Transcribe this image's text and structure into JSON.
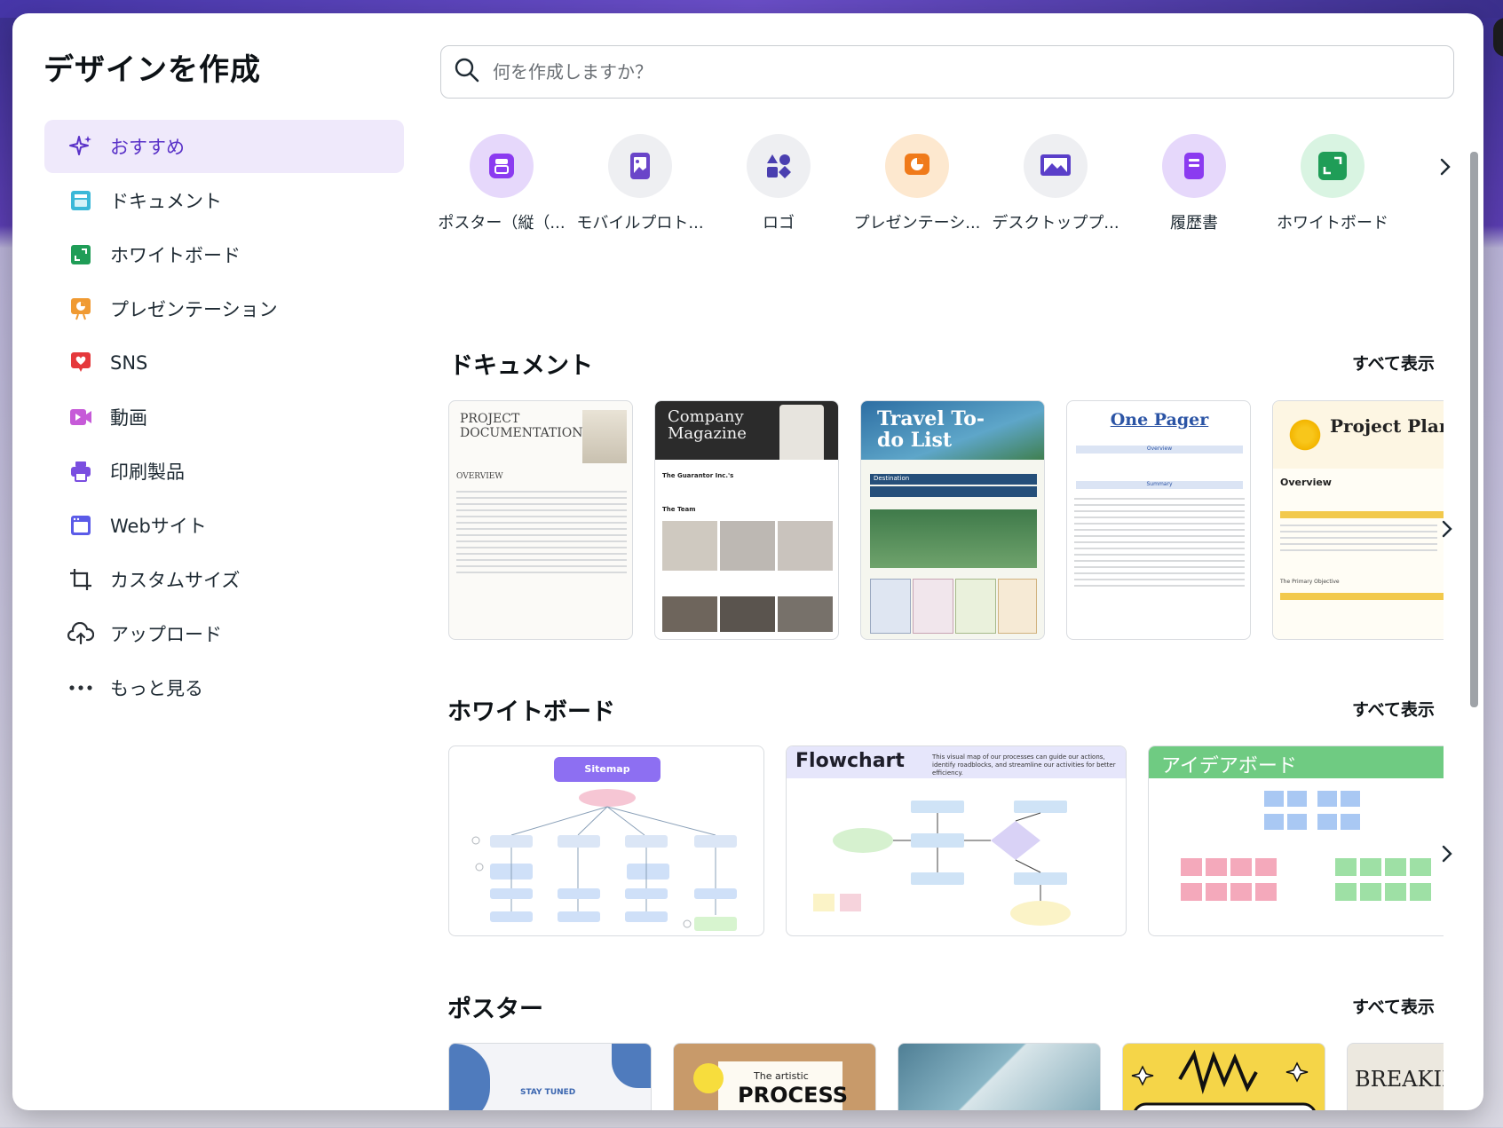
{
  "modal": {
    "title": "デザインを作成"
  },
  "sidebar": {
    "items": [
      {
        "label": "おすすめ",
        "icon": "sparkle-icon"
      },
      {
        "label": "ドキュメント",
        "icon": "doc-icon"
      },
      {
        "label": "ホワイトボード",
        "icon": "whiteboard-icon"
      },
      {
        "label": "プレゼンテーション",
        "icon": "presentation-icon"
      },
      {
        "label": "SNS",
        "icon": "heart-icon"
      },
      {
        "label": "動画",
        "icon": "video-icon"
      },
      {
        "label": "印刷製品",
        "icon": "printer-icon"
      },
      {
        "label": "Webサイト",
        "icon": "website-icon"
      },
      {
        "label": "カスタムサイズ",
        "icon": "crop-icon"
      },
      {
        "label": "アップロード",
        "icon": "upload-icon"
      },
      {
        "label": "もっと見る",
        "icon": "more-icon"
      }
    ]
  },
  "search": {
    "placeholder": "何を作成しますか？"
  },
  "quick": {
    "items": [
      {
        "label": "ポスター（縦（...",
        "color": "#e6d8fb",
        "icon": "poster-icon"
      },
      {
        "label": "モバイルプロト...",
        "color": "#eeeff2",
        "icon": "mobile-icon"
      },
      {
        "label": "ロゴ",
        "color": "#eeeff2",
        "icon": "logo-icon"
      },
      {
        "label": "プレゼンテーシ...",
        "color": "#fde8cf",
        "icon": "presentation-icon"
      },
      {
        "label": "デスクトッププ...",
        "color": "#eeeff2",
        "icon": "desktop-icon"
      },
      {
        "label": "履歴書",
        "color": "#e6d8fb",
        "icon": "resume-icon"
      },
      {
        "label": "ホワイトボード",
        "color": "#d9f4e2",
        "icon": "whiteboard-icon"
      }
    ]
  },
  "sections": {
    "documents": {
      "title": "ドキュメント",
      "see_all": "すべて表示",
      "cards": [
        {
          "title": "PROJECT DOCUMENTATION",
          "subtitle": "OVERVIEW"
        },
        {
          "title": "Company Magazine",
          "subtitle": "The Guarantor Inc.'s",
          "sub2": "The Team"
        },
        {
          "title": "Travel To-do List",
          "subtitle": "Destination"
        },
        {
          "title": "One Pager",
          "subtitle": "Overview",
          "sub2": "Summary"
        },
        {
          "title": "Project Plan",
          "subtitle": "Overview",
          "sub2": "The Primary Objective"
        }
      ]
    },
    "whiteboards": {
      "title": "ホワイトボード",
      "see_all": "すべて表示",
      "cards": [
        {
          "title": "Sitemap"
        },
        {
          "title": "Flowchart",
          "subtitle": "This visual map of our processes can guide our actions, identify roadblocks, and streamline our activities for better efficiency."
        },
        {
          "title": "アイデアボード"
        }
      ]
    },
    "posters": {
      "title": "ポスター",
      "see_all": "すべて表示",
      "cards": [
        {
          "title": "STAY TUNED"
        },
        {
          "title": "The artistic",
          "subtitle": "PROCESS"
        },
        {
          "title": ""
        },
        {
          "title": ""
        },
        {
          "title": "BREAKIN"
        }
      ]
    }
  }
}
